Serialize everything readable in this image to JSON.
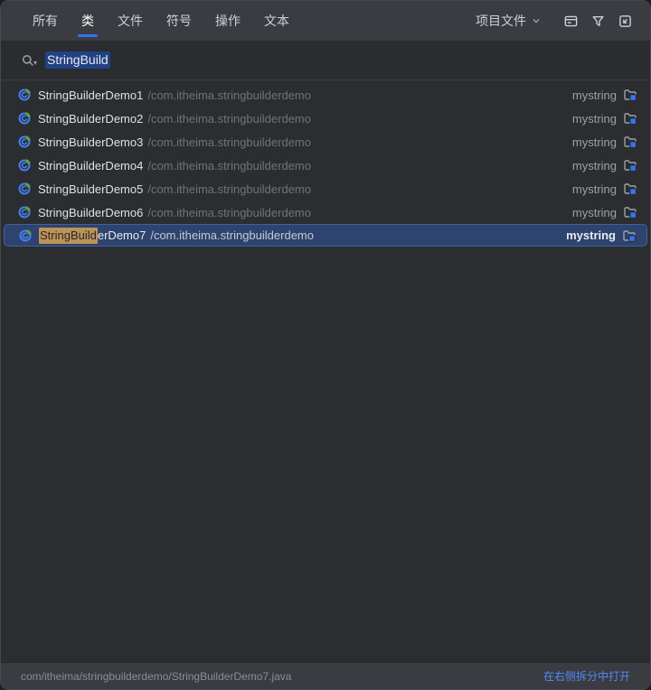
{
  "tabs": {
    "items": [
      {
        "label": "所有"
      },
      {
        "label": "类"
      },
      {
        "label": "文件"
      },
      {
        "label": "符号"
      },
      {
        "label": "操作"
      },
      {
        "label": "文本"
      }
    ],
    "selected_label": "类",
    "scope_label": "项目文件"
  },
  "header_icons": [
    "preview-icon",
    "filter-icon",
    "open-in-find-window-icon"
  ],
  "search": {
    "value": "StringBuild"
  },
  "results": [
    {
      "name": "StringBuilderDemo1",
      "path": "/com.itheima.stringbuilderdemo",
      "module": "mystring"
    },
    {
      "name": "StringBuilderDemo2",
      "path": "/com.itheima.stringbuilderdemo",
      "module": "mystring"
    },
    {
      "name": "StringBuilderDemo3",
      "path": "/com.itheima.stringbuilderdemo",
      "module": "mystring"
    },
    {
      "name": "StringBuilderDemo4",
      "path": "/com.itheima.stringbuilderdemo",
      "module": "mystring"
    },
    {
      "name": "StringBuilderDemo5",
      "path": "/com.itheima.stringbuilderdemo",
      "module": "mystring"
    },
    {
      "name": "StringBuilderDemo6",
      "path": "/com.itheima.stringbuilderdemo",
      "module": "mystring"
    },
    {
      "name": "StringBuilderDemo7",
      "name_match": "StringBuild",
      "name_rest": "erDemo7",
      "path": "/com.itheima.stringbuilderdemo",
      "module": "mystring",
      "selected": true
    }
  ],
  "footer": {
    "file_path": "com/itheima/stringbuilderdemo/StringBuilderDemo7.java",
    "action_label": "在右侧拆分中打开"
  },
  "colors": {
    "accent": "#3574F0",
    "header_bg": "#3A3C41",
    "body_bg": "#2B2D30",
    "selection_row_bg": "#2E436E",
    "match_highlight_bg": "#BD9356",
    "search_selection_bg": "#214283",
    "link_blue": "#548AF7",
    "primary_text": "#DFE1E5",
    "secondary_text": "#6F737A"
  }
}
